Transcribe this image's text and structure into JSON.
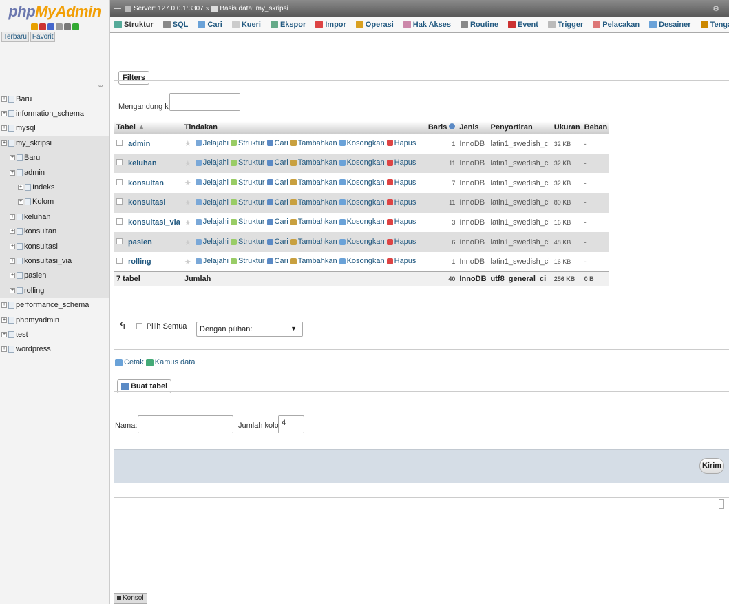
{
  "brand": {
    "php": "php",
    "myadmin": "MyAdmin"
  },
  "sidebar": {
    "tabs": [
      "Terbaru",
      "Favorit"
    ],
    "collapse": "∞",
    "tree": [
      {
        "label": "Baru",
        "indent": 0
      },
      {
        "label": "information_schema",
        "indent": 0
      },
      {
        "label": "mysql",
        "indent": 0
      },
      {
        "label": "my_skripsi",
        "indent": 0
      },
      {
        "label": "Baru",
        "indent": 1
      },
      {
        "label": "admin",
        "indent": 1
      },
      {
        "label": "Indeks",
        "indent": 2
      },
      {
        "label": "Kolom",
        "indent": 2
      },
      {
        "label": "keluhan",
        "indent": 1
      },
      {
        "label": "konsultan",
        "indent": 1
      },
      {
        "label": "konsultasi",
        "indent": 1
      },
      {
        "label": "konsultasi_via",
        "indent": 1
      },
      {
        "label": "pasien",
        "indent": 1
      },
      {
        "label": "rolling",
        "indent": 1
      },
      {
        "label": "performance_schema",
        "indent": 0
      },
      {
        "label": "phpmyadmin",
        "indent": 0
      },
      {
        "label": "test",
        "indent": 0
      },
      {
        "label": "wordpress",
        "indent": 0
      }
    ]
  },
  "breadcrumb": {
    "server": "Server: 127.0.0.1:3307",
    "database": "Basis data: my_skripsi"
  },
  "tabs": [
    "Struktur",
    "SQL",
    "Cari",
    "Kueri",
    "Ekspor",
    "Impor",
    "Operasi",
    "Hak Akses",
    "Routine",
    "Event",
    "Trigger",
    "Pelacakan",
    "Desainer",
    "Tengah kolom"
  ],
  "filters": {
    "legend": "Filters",
    "label": "Mengandung kata:",
    "value": ""
  },
  "table": {
    "headers": {
      "table": "Tabel",
      "actions": "Tindakan",
      "rows": "Baris",
      "type": "Jenis",
      "collation": "Penyortiran",
      "size": "Ukuran",
      "overhead": "Beban"
    },
    "actions": [
      "Jelajahi",
      "Struktur",
      "Cari",
      "Tambahkan",
      "Kosongkan",
      "Hapus"
    ],
    "rows": [
      {
        "name": "admin",
        "rows": "1",
        "type": "InnoDB",
        "collation": "latin1_swedish_ci",
        "size": "32 KB",
        "overhead": "-"
      },
      {
        "name": "keluhan",
        "rows": "11",
        "type": "InnoDB",
        "collation": "latin1_swedish_ci",
        "size": "32 KB",
        "overhead": "-"
      },
      {
        "name": "konsultan",
        "rows": "7",
        "type": "InnoDB",
        "collation": "latin1_swedish_ci",
        "size": "32 KB",
        "overhead": "-"
      },
      {
        "name": "konsultasi",
        "rows": "11",
        "type": "InnoDB",
        "collation": "latin1_swedish_ci",
        "size": "80 KB",
        "overhead": "-"
      },
      {
        "name": "konsultasi_via",
        "rows": "3",
        "type": "InnoDB",
        "collation": "latin1_swedish_ci",
        "size": "16 KB",
        "overhead": "-"
      },
      {
        "name": "pasien",
        "rows": "6",
        "type": "InnoDB",
        "collation": "latin1_swedish_ci",
        "size": "48 KB",
        "overhead": "-"
      },
      {
        "name": "rolling",
        "rows": "1",
        "type": "InnoDB",
        "collation": "latin1_swedish_ci",
        "size": "16 KB",
        "overhead": "-"
      }
    ],
    "footer": {
      "count": "7 tabel",
      "sum": "Jumlah",
      "rows": "40",
      "type": "InnoDB",
      "collation": "utf8_general_ci",
      "size": "256 KB",
      "overhead": "0 B"
    }
  },
  "bulk": {
    "check_all": "Pilih Semua",
    "with_selected": "Dengan pilihan:"
  },
  "links": {
    "print": "Cetak",
    "dictionary": "Kamus data"
  },
  "create": {
    "legend": "Buat tabel",
    "name_label": "Nama:",
    "name_value": "",
    "cols_label": "Jumlah kolom:",
    "cols_value": "4",
    "submit": "Kirim"
  },
  "console": "Konsol"
}
